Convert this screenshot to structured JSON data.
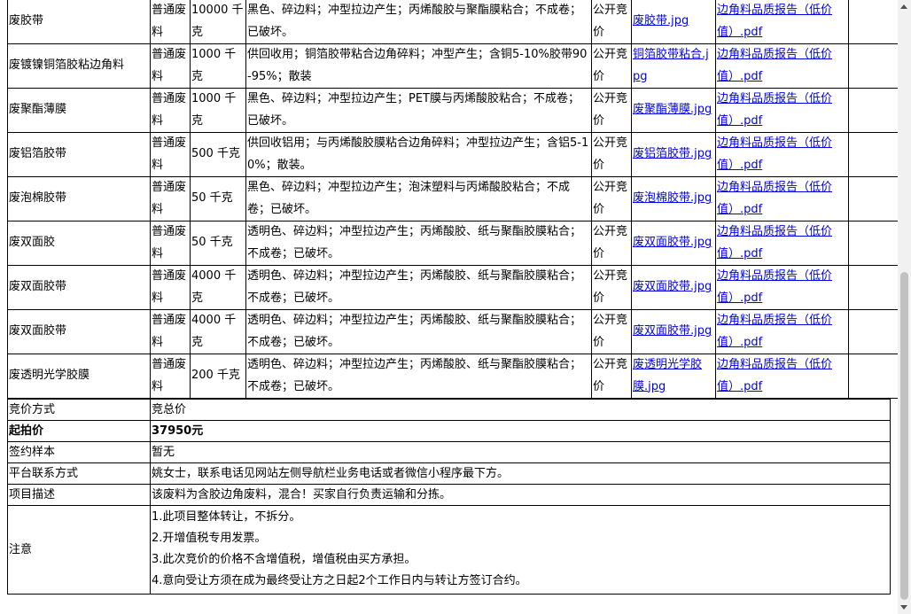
{
  "items": [
    {
      "name": "废胶带",
      "type": "普通废料",
      "qty": "10000 千克",
      "desc": "黑色、碎边料；冲型拉边产生；丙烯酸胶与聚酯膜粘合；不成卷；已破坏。",
      "method": "公开竞价",
      "image": "废胶带.jpg",
      "report": "边角料品质报告（低价值）.pdf"
    },
    {
      "name": "废镀镍铜箔胶粘边角料",
      "type": "普通废料",
      "qty": "1000 千克",
      "desc": "供回收用；铜箔胶带粘合边角碎料；冲型产生；含铜5-10%胶带90-95%；散装",
      "method": "公开竞价",
      "image": "铜箔胶带粘合.jpg",
      "report": "边角料品质报告（低价值）.pdf"
    },
    {
      "name": "废聚酯薄膜",
      "type": "普通废料",
      "qty": "1000 千克",
      "desc": "黑色、碎边料；冲型拉边产生；PET膜与丙烯酸胶粘合；不成卷；已破坏。",
      "method": "公开竞价",
      "image": "废聚酯薄膜.jpg",
      "report": "边角料品质报告（低价值）.pdf"
    },
    {
      "name": "废铝箔胶带",
      "type": "普通废料",
      "qty": "500 千克",
      "desc": "供回收铝用；与丙烯酸胶膜粘合边角碎料；冲型拉边产生；含铝5-10%；散装。",
      "method": "公开竞价",
      "image": "废铝箔胶带.jpg",
      "report": "边角料品质报告（低价值）.pdf"
    },
    {
      "name": "废泡棉胶带",
      "type": "普通废料",
      "qty": "50 千克",
      "desc": "黑色、碎边料；冲型拉边产生；泡沫塑料与丙烯酸胶粘合；不成卷；已破坏。",
      "method": "公开竞价",
      "image": "废泡棉胶带.jpg",
      "report": "边角料品质报告（低价值）.pdf"
    },
    {
      "name": "废双面胶",
      "type": "普通废料",
      "qty": "50 千克",
      "desc": "透明色、碎边料；冲型拉边产生；丙烯酸胶、纸与聚酯胶膜粘合；不成卷；已破坏。",
      "method": "公开竞价",
      "image": "废双面胶带.jpg",
      "report": "边角料品质报告（低价值）.pdf"
    },
    {
      "name": "废双面胶带",
      "type": "普通废料",
      "qty": "4000 千克",
      "desc": "透明色、碎边料；冲型拉边产生；丙烯酸胶、纸与聚酯胶膜粘合；不成卷；已破坏。",
      "method": "公开竞价",
      "image": "废双面胶带.jpg",
      "report": "边角料品质报告（低价值）.pdf"
    },
    {
      "name": "废双面胶带",
      "type": "普通废料",
      "qty": "4000 千克",
      "desc": "透明色、碎边料；冲型拉边产生；丙烯酸胶、纸与聚酯胶膜粘合；不成卷；已破坏。",
      "method": "公开竞价",
      "image": "废双面胶带.jpg",
      "report": "边角料品质报告（低价值）.pdf"
    },
    {
      "name": "废透明光学胶膜",
      "type": "普通废料",
      "qty": "200 千克",
      "desc": "透明色、碎边料；冲型拉边产生；丙烯酸胶、纸与聚酯胶膜粘合；不成卷；已破坏。",
      "method": "公开竞价",
      "image": "废透明光学胶膜.jpg",
      "report": "边角料品质报告（低价值）.pdf"
    }
  ],
  "info": {
    "bid_method_label": "竞价方式",
    "bid_method": "竞总价",
    "start_price_label": "起拍价",
    "start_price": "37950元",
    "sample_label": "签约样本",
    "sample": "暂无",
    "contact_label": "平台联系方式",
    "contact": "姚女士，联系电话见网站左侧导航栏业务电话或者微信小程序最下方。",
    "desc_label": "项目描述",
    "desc": "该废料为含胶边角废料，混合！买家自行负责运输和分拣。",
    "notes_label": "注意",
    "notes": [
      "1.此项目整体转让，不拆分。",
      "2.开增值税专用发票。",
      "3.此次竞价的价格不含增值税，增值税由买方承担。",
      "4.意向受让方须在成为最终受让方之日起2个工作日内与转让方签订合约。"
    ]
  }
}
